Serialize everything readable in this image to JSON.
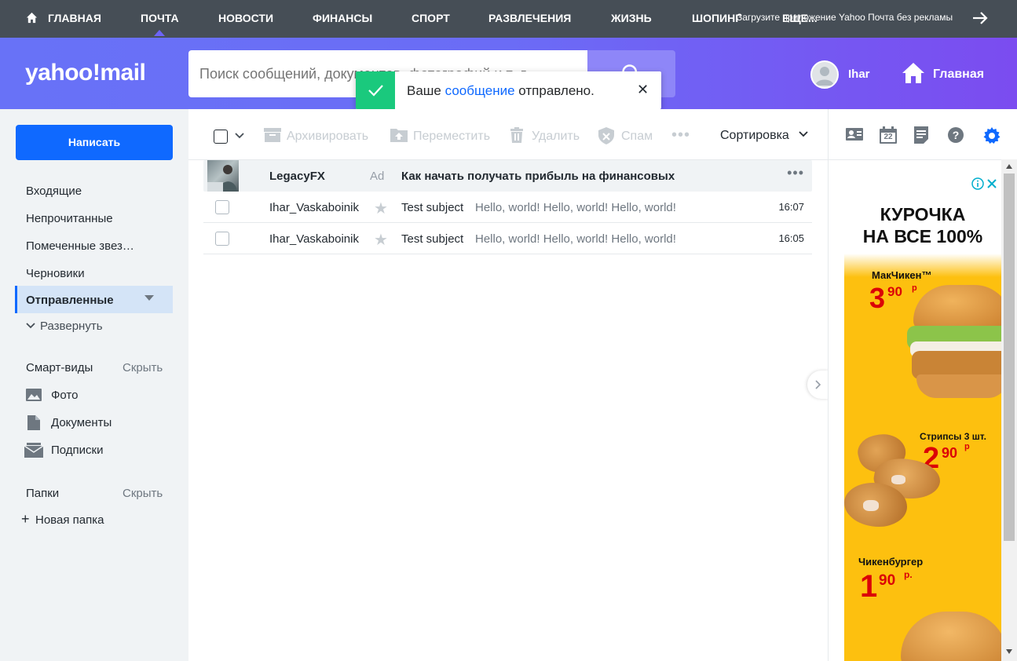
{
  "topnav": {
    "items": [
      "ГЛАВНАЯ",
      "ПОЧТА",
      "НОВОСТИ",
      "ФИНАНСЫ",
      "СПОРТ",
      "РАЗВЛЕЧЕНИЯ",
      "ЖИЗНЬ",
      "ШОПИНГ",
      "ЕЩЕ..."
    ],
    "active": "ПОЧТА",
    "promo": "Загрузите приложение Yahoo Почта без рекламы"
  },
  "header": {
    "logo": "yahoo!mail",
    "search_placeholder": "Поиск сообщений, документов, фотографий и т. д.",
    "user_name": "Ihar",
    "home_label": "Главная"
  },
  "toast": {
    "prefix": "Ваше",
    "link": "сообщение",
    "suffix": "отправлено."
  },
  "sidebar": {
    "compose": "Написать",
    "folders": [
      "Входящие",
      "Непрочитанные",
      "Помеченные звез…",
      "Черновики"
    ],
    "active_folder": "Отправленные",
    "expand": "Развернуть",
    "smart_title": "Смарт-виды",
    "smart_hide": "Скрыть",
    "smart_items": [
      "Фото",
      "Документы",
      "Подписки"
    ],
    "folders_title": "Папки",
    "folders_hide": "Скрыть",
    "new_folder": "Новая папка"
  },
  "toolbar": {
    "archive": "Архивировать",
    "move": "Переместить",
    "delete": "Удалить",
    "spam": "Спам",
    "sort": "Сортировка"
  },
  "messages": {
    "ad": {
      "sender": "LegacyFX",
      "tag": "Ad",
      "subject": "Как начать получать прибыль на финансовых"
    },
    "rows": [
      {
        "sender": "Ihar_Vaskaboinik",
        "subject": "Test subject",
        "snippet": "Hello, world! Hello, world! Hello, world!",
        "time": "16:07"
      },
      {
        "sender": "Ihar_Vaskaboinik",
        "subject": "Test subject",
        "snippet": "Hello, world! Hello, world! Hello, world!",
        "time": "16:05"
      }
    ]
  },
  "right_tools": {
    "calendar_day": "22"
  },
  "advert": {
    "headline_1": "КУРОЧКА",
    "headline_2": "НА ВСЕ 100%",
    "item1_name": "МакЧикен™",
    "item1_price": "3",
    "item1_cents": "90",
    "item1_unit": "р",
    "item2_name": "Стрипсы 3 шт.",
    "item2_price": "2",
    "item2_cents": "90",
    "item2_unit": "р",
    "item3_name": "Чикенбургер",
    "item3_price": "1",
    "item3_cents": "90",
    "item3_unit": "р."
  }
}
